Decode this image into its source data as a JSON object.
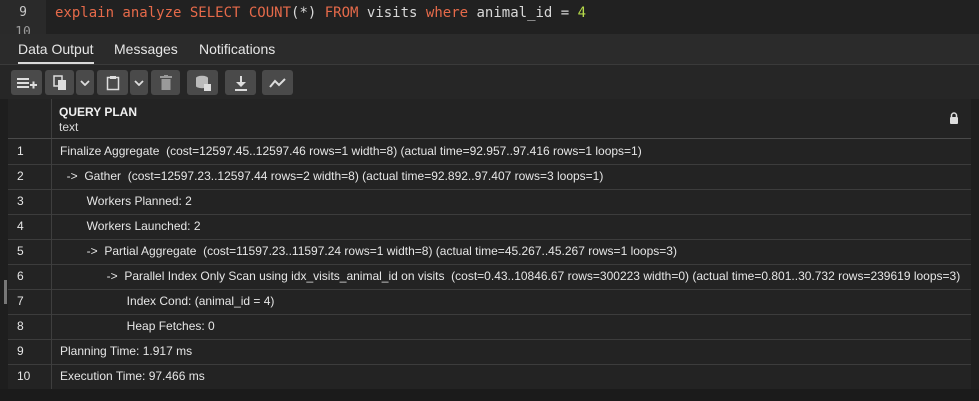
{
  "editor": {
    "line_numbers": [
      "9",
      "10"
    ],
    "query": {
      "t1": "explain analyze SELECT COUNT",
      "t2": "(*)",
      "t3": " FROM",
      "t4": " visits",
      "t5": " where",
      "t6": " animal_id = ",
      "t7": "4"
    }
  },
  "tabs": [
    "Data Output",
    "Messages",
    "Notifications"
  ],
  "toolbar": {
    "icons": [
      "add-row-icon",
      "copy-icon",
      "dropdown-icon",
      "paste-icon",
      "dropdown-icon",
      "delete-icon",
      "save-data-icon",
      "download-icon",
      "graph-visualiser-icon"
    ]
  },
  "grid": {
    "column": {
      "name": "QUERY PLAN",
      "type": "text"
    },
    "rows": [
      {
        "n": "1",
        "v": "Finalize Aggregate  (cost=12597.45..12597.46 rows=1 width=8) (actual time=92.957..97.416 rows=1 loops=1)"
      },
      {
        "n": "2",
        "v": "  ->  Gather  (cost=12597.23..12597.44 rows=2 width=8) (actual time=92.892..97.407 rows=3 loops=1)"
      },
      {
        "n": "3",
        "v": "        Workers Planned: 2"
      },
      {
        "n": "4",
        "v": "        Workers Launched: 2"
      },
      {
        "n": "5",
        "v": "        ->  Partial Aggregate  (cost=11597.23..11597.24 rows=1 width=8) (actual time=45.267..45.267 rows=1 loops=3)"
      },
      {
        "n": "6",
        "v": "              ->  Parallel Index Only Scan using idx_visits_animal_id on visits  (cost=0.43..10846.67 rows=300223 width=0) (actual time=0.801..30.732 rows=239619 loops=3)"
      },
      {
        "n": "7",
        "v": "                    Index Cond: (animal_id = 4)"
      },
      {
        "n": "8",
        "v": "                    Heap Fetches: 0"
      },
      {
        "n": "9",
        "v": "Planning Time: 1.917 ms"
      },
      {
        "n": "10",
        "v": "Execution Time: 97.466 ms"
      }
    ]
  },
  "colors": {
    "keyword": "#e66a4a",
    "number": "#b5d94a",
    "background": "#1e1e1e"
  }
}
